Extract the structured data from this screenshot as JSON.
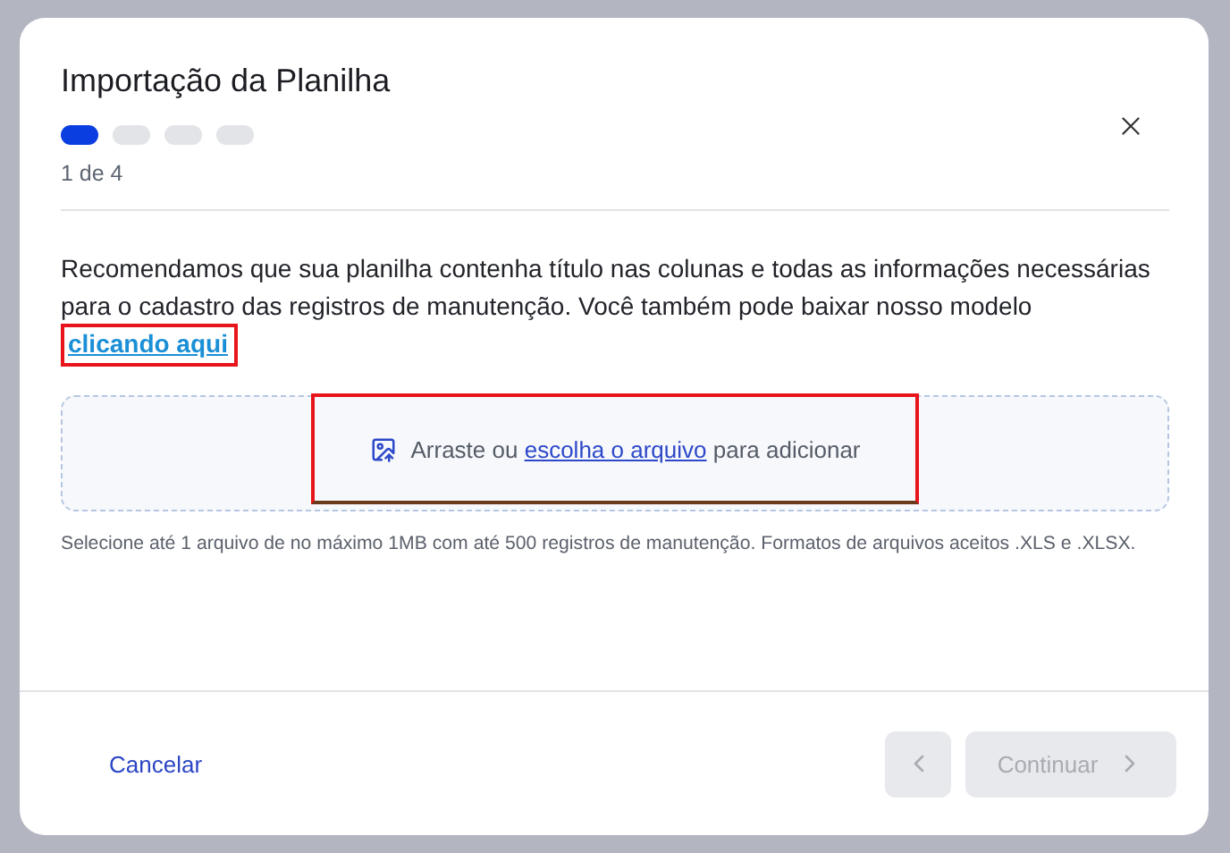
{
  "dialog": {
    "title": "Importação da Planilha"
  },
  "steps": [
    {
      "selected": true
    },
    {
      "selected": false
    },
    {
      "selected": false
    },
    {
      "selected": false
    }
  ],
  "step_label": "1 de 4",
  "intro": {
    "text": "Recomendamos que sua planilha contenha título nas colunas e todas as informações necessárias para o cadastro das registros de manutenção. Você também pode baixar nosso modelo",
    "link": "clicando aqui"
  },
  "dropzone": {
    "before": "Arraste ou",
    "link": "escolha o arquivo",
    "after": "para adicionar"
  },
  "hint": "Selecione até 1 arquivo de no máximo 1MB com até 500 registros de manutenção. Formatos de arquivos aceitos .XLS e .XLSX.",
  "footer": {
    "cancel": "Cancelar",
    "back": {
      "disabled": true
    },
    "continue": {
      "label": "Continuar",
      "disabled": true
    }
  }
}
